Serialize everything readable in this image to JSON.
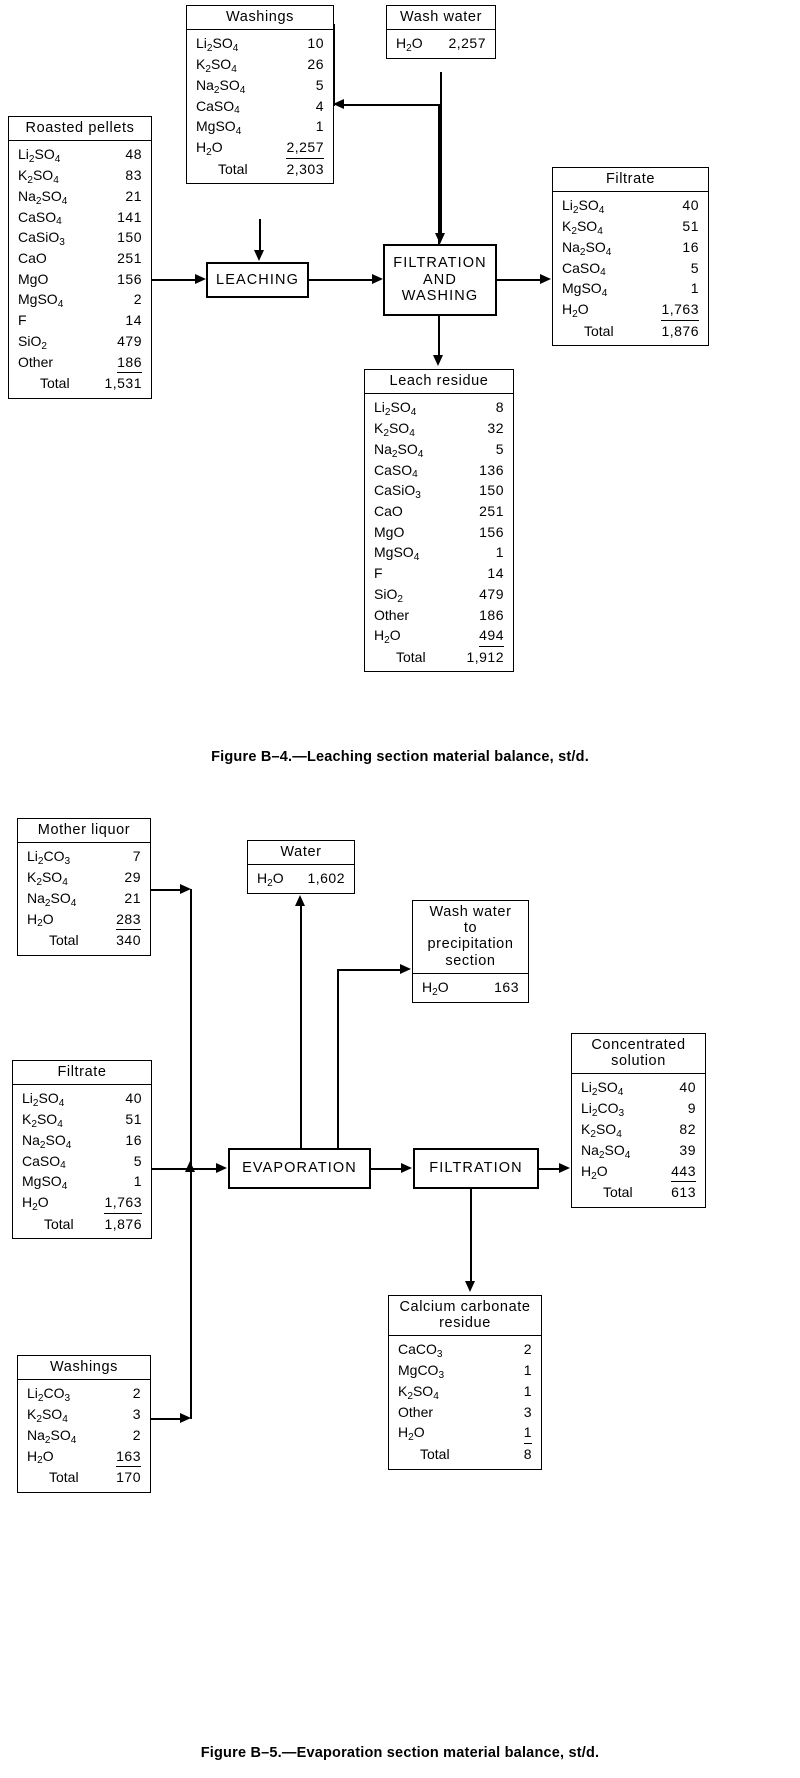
{
  "figures": [
    {
      "id": "figure-b4",
      "caption": "Figure  B–4.—Leaching section material balance, st/d.",
      "process_boxes": [
        {
          "name": "leaching",
          "label": "LEACHING"
        },
        {
          "name": "filtration-and-washing",
          "label": "FILTRATION\nAND\nWASHING"
        }
      ],
      "stream_boxes": [
        {
          "name": "washings",
          "title": "Washings",
          "rows": [
            {
              "label": "Li2SO4",
              "value": "10"
            },
            {
              "label": "K2SO4",
              "value": "26"
            },
            {
              "label": "Na2SO4",
              "value": "5"
            },
            {
              "label": "CaSO4",
              "value": "4"
            },
            {
              "label": "MgSO4",
              "value": "1"
            },
            {
              "label": "H2O",
              "value": "2,257",
              "rule": true
            },
            {
              "label": "Total",
              "value": "2,303",
              "total": true
            }
          ]
        },
        {
          "name": "wash-water",
          "title": "Wash water",
          "rows": [
            {
              "label": "H2O",
              "value": "2,257"
            }
          ]
        },
        {
          "name": "roasted-pellets",
          "title": "Roasted  pellets",
          "rows": [
            {
              "label": "Li2SO4",
              "value": "48"
            },
            {
              "label": "K2SO4",
              "value": "83"
            },
            {
              "label": "Na2SO4",
              "value": "21"
            },
            {
              "label": "CaSO4",
              "value": "141"
            },
            {
              "label": "CaSiO3",
              "value": "150"
            },
            {
              "label": "CaO",
              "value": "251"
            },
            {
              "label": "MgO",
              "value": "156"
            },
            {
              "label": "MgSO4",
              "value": "2"
            },
            {
              "label": "F",
              "value": "14"
            },
            {
              "label": "SiO2",
              "value": "479"
            },
            {
              "label": "Other",
              "value": "186",
              "rule": true
            },
            {
              "label": "Total",
              "value": "1,531",
              "total": true
            }
          ]
        },
        {
          "name": "filtrate",
          "title": "Filtrate",
          "rows": [
            {
              "label": "Li2SO4",
              "value": "40"
            },
            {
              "label": "K2SO4",
              "value": "51"
            },
            {
              "label": "Na2SO4",
              "value": "16"
            },
            {
              "label": "CaSO4",
              "value": "5"
            },
            {
              "label": "MgSO4",
              "value": "1"
            },
            {
              "label": "H2O",
              "value": "1,763",
              "rule": true
            },
            {
              "label": "Total",
              "value": "1,876",
              "total": true
            }
          ]
        },
        {
          "name": "leach-residue",
          "title": "Leach residue",
          "rows": [
            {
              "label": "Li2SO4",
              "value": "8"
            },
            {
              "label": "K2SO4",
              "value": "32"
            },
            {
              "label": "Na2SO4",
              "value": "5"
            },
            {
              "label": "CaSO4",
              "value": "136"
            },
            {
              "label": "CaSiO3",
              "value": "150"
            },
            {
              "label": "CaO",
              "value": "251"
            },
            {
              "label": "MgO",
              "value": "156"
            },
            {
              "label": "MgSO4",
              "value": "1"
            },
            {
              "label": "F",
              "value": "14"
            },
            {
              "label": "SiO2",
              "value": "479"
            },
            {
              "label": "Other",
              "value": "186"
            },
            {
              "label": "H2O",
              "value": "494",
              "rule": true
            },
            {
              "label": "Total",
              "value": "1,912",
              "total": true
            }
          ]
        }
      ]
    },
    {
      "id": "figure-b5",
      "caption": "Figure  B–5.—Evaporation section material balance, st/d.",
      "process_boxes": [
        {
          "name": "evaporation",
          "label": "EVAPORATION"
        },
        {
          "name": "filtration",
          "label": "FILTRATION"
        }
      ],
      "stream_boxes": [
        {
          "name": "mother-liquor",
          "title": "Mother liquor",
          "rows": [
            {
              "label": "Li2CO3",
              "value": "7"
            },
            {
              "label": "K2SO4",
              "value": "29"
            },
            {
              "label": "Na2SO4",
              "value": "21"
            },
            {
              "label": "H2O",
              "value": "283",
              "rule": true
            },
            {
              "label": "Total",
              "value": "340",
              "total": true
            }
          ]
        },
        {
          "name": "water",
          "title": "Water",
          "rows": [
            {
              "label": "H2O",
              "value": "1,602"
            }
          ]
        },
        {
          "name": "wash-water-to-precipitation-section",
          "title": "Wash water\nto\nprecipitation\nsection",
          "rows": [
            {
              "label": "H2O",
              "value": "163"
            }
          ]
        },
        {
          "name": "filtrate",
          "title": "Filtrate",
          "rows": [
            {
              "label": "Li2SO4",
              "value": "40"
            },
            {
              "label": "K2SO4",
              "value": "51"
            },
            {
              "label": "Na2SO4",
              "value": "16"
            },
            {
              "label": "CaSO4",
              "value": "5"
            },
            {
              "label": "MgSO4",
              "value": "1"
            },
            {
              "label": "H2O",
              "value": "1,763",
              "rule": true
            },
            {
              "label": "Total",
              "value": "1,876",
              "total": true
            }
          ]
        },
        {
          "name": "concentrated-solution",
          "title": "Concentrated\nsolution",
          "rows": [
            {
              "label": "Li2SO4",
              "value": "40"
            },
            {
              "label": "Li2CO3",
              "value": "9"
            },
            {
              "label": "K2SO4",
              "value": "82"
            },
            {
              "label": "Na2SO4",
              "value": "39"
            },
            {
              "label": "H2O",
              "value": "443",
              "rule": true
            },
            {
              "label": "Total",
              "value": "613",
              "total": true
            }
          ]
        },
        {
          "name": "washings",
          "title": "Washings",
          "rows": [
            {
              "label": "Li2CO3",
              "value": "2"
            },
            {
              "label": "K2SO4",
              "value": "3"
            },
            {
              "label": "Na2SO4",
              "value": "2"
            },
            {
              "label": "H2O",
              "value": "163",
              "rule": true
            },
            {
              "label": "Total",
              "value": "170",
              "total": true
            }
          ]
        },
        {
          "name": "calcium-carbonate-residue",
          "title": "Calcium carbonate\nresidue",
          "rows": [
            {
              "label": "CaCO3",
              "value": "2"
            },
            {
              "label": "MgCO3",
              "value": "1"
            },
            {
              "label": "K2SO4",
              "value": "1"
            },
            {
              "label": "Other",
              "value": "3"
            },
            {
              "label": "H2O",
              "value": "1",
              "rule": true
            },
            {
              "label": "Total",
              "value": "8",
              "total": true
            }
          ]
        }
      ]
    }
  ]
}
